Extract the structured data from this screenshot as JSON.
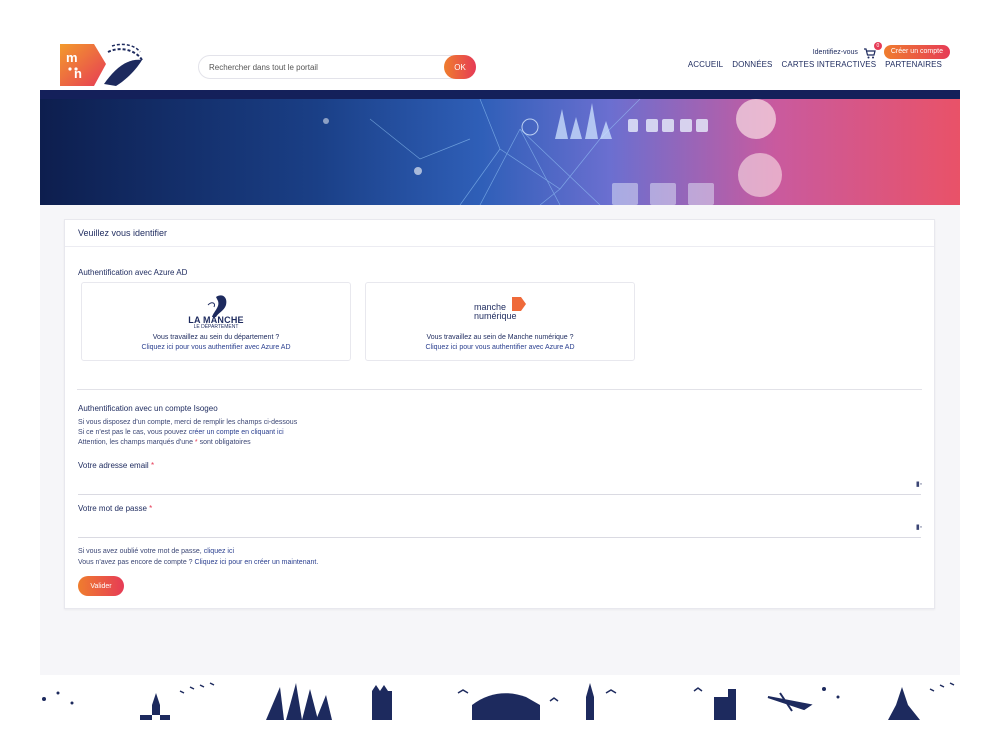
{
  "header": {
    "logo_text": "m:n",
    "search_placeholder": "Rechercher dans tout le portail",
    "search_button": "OK",
    "identify_label": "Identifiez-vous",
    "cart_count": "0",
    "create_account_label": "Créer un compte",
    "nav": [
      "ACCUEIL",
      "DONNÉES",
      "CARTES INTERACTIVES",
      "PARTENAIRES"
    ]
  },
  "login": {
    "title": "Veuillez vous identifier",
    "azure": {
      "section_title": "Authentification avec Azure AD",
      "providers": [
        {
          "logo_line1": "LA MANCHE",
          "logo_line2": "LE DÉPARTEMENT",
          "question": "Vous travaillez au sein du département ?",
          "link": "Cliquez ici pour vous authentifier avec Azure AD"
        },
        {
          "logo_line1": "manche",
          "logo_line2": "numérique",
          "question": "Vous travaillez au sein de Manche numérique ?",
          "link": "Cliquez ici pour vous authentifier avec Azure AD"
        }
      ]
    },
    "isogeo": {
      "section_title": "Authentification avec un compte Isogeo",
      "line1": "Si vous disposez d'un compte, merci de remplir les champs ci-dessous",
      "line2_prefix": "Si ce n'est pas le cas, vous pouvez",
      "line2_link": "créer un compte en cliquant ici",
      "line3_prefix": "Attention, les champs marqués d'une",
      "line3_star": "*",
      "line3_suffix": "sont obligatoires",
      "email_label": "Votre adresse email",
      "password_label": "Votre mot de passe",
      "required_star": "*",
      "forgot_prefix": "Si vous avez oublié votre mot de passe,",
      "forgot_link": "cliquez ici",
      "noaccount_prefix": "Vous n'avez pas encore de compte ?",
      "noaccount_link": "Cliquez ici pour en créer un maintenant.",
      "submit": "Valider"
    }
  },
  "colors": {
    "navy": "#1d2a5e",
    "accent_start": "#ef7d2e",
    "accent_end": "#e63b56",
    "link": "#2a3f8f"
  }
}
